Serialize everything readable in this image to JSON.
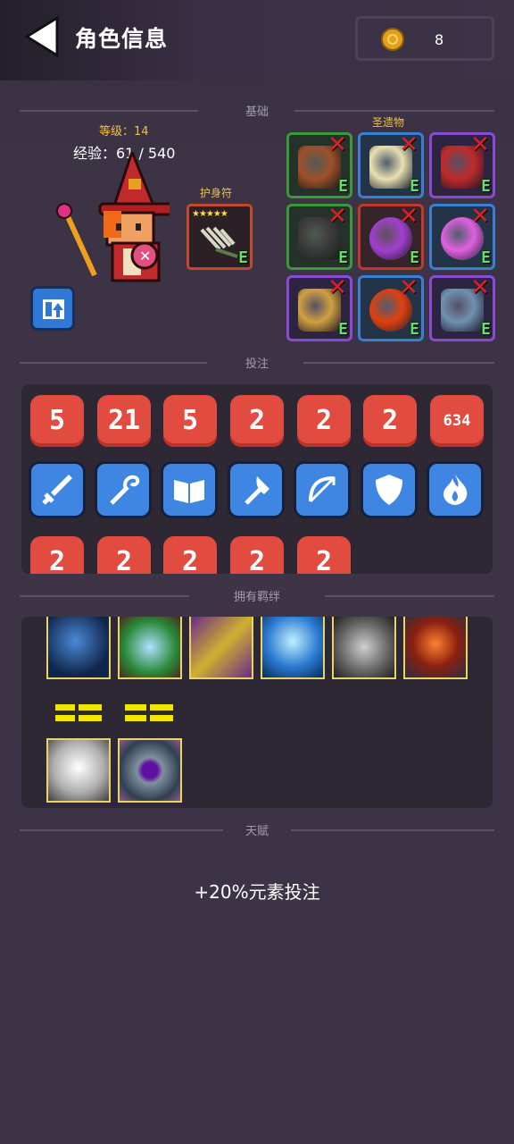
{
  "header": {
    "title": "角色信息",
    "coins": "8"
  },
  "sections": {
    "base": "基础",
    "bets": "投注",
    "bonds": "拥有羁绊",
    "talent": "天赋"
  },
  "character": {
    "level": "等级：14",
    "experience": "经验：61 / 540"
  },
  "amulet": {
    "label": "护身符",
    "stars": "★★★★★",
    "badge": "E"
  },
  "relics": {
    "label": "圣遗物",
    "items": [
      {
        "name": "relic-mushroom-brown",
        "border": "#3a9a3a",
        "badge": "E",
        "removed": true
      },
      {
        "name": "relic-bread",
        "border": "#3a7fd6",
        "badge": "E",
        "removed": true
      },
      {
        "name": "relic-mushroom-red",
        "border": "#8a4ad6",
        "badge": "E",
        "removed": true
      },
      {
        "name": "relic-goggles",
        "border": "#3a9a3a",
        "badge": "E",
        "removed": true
      },
      {
        "name": "relic-purple-orb",
        "border": "#c03a2a",
        "badge": "E",
        "removed": true
      },
      {
        "name": "relic-pink-orb",
        "border": "#3a7fd6",
        "badge": "E",
        "removed": true
      },
      {
        "name": "relic-wand",
        "border": "#8a4ad6",
        "badge": "E",
        "removed": true
      },
      {
        "name": "relic-fire-orb",
        "border": "#3a7fd6",
        "badge": "E",
        "removed": true
      },
      {
        "name": "relic-potion",
        "border": "#8a4ad6",
        "badge": "E",
        "removed": true
      }
    ],
    "remove_mark": "✕"
  },
  "bets": {
    "numbers": [
      "5",
      "21",
      "5",
      "2",
      "2",
      "2",
      "634"
    ],
    "weapons": [
      "sword-icon",
      "staff-icon",
      "book-icon",
      "axe-icon",
      "bow-icon",
      "shield-icon",
      "fire-icon"
    ],
    "numbers_row3": [
      "2",
      "2",
      "2",
      "2",
      "2"
    ]
  },
  "bonds": {
    "row1": [
      "bond-mind",
      "bond-nature",
      "bond-golden",
      "bond-ascend",
      "bond-stone",
      "bond-explosion"
    ],
    "row2": [
      "bond-ghost",
      "bond-vortex"
    ]
  },
  "talent": {
    "text": "+20%元素投注"
  },
  "colors": {
    "bet_red": "#e24b3f",
    "weapon_blue": "#3e86e2",
    "gold": "#f0c040",
    "bond_border": "#e9d36a"
  }
}
